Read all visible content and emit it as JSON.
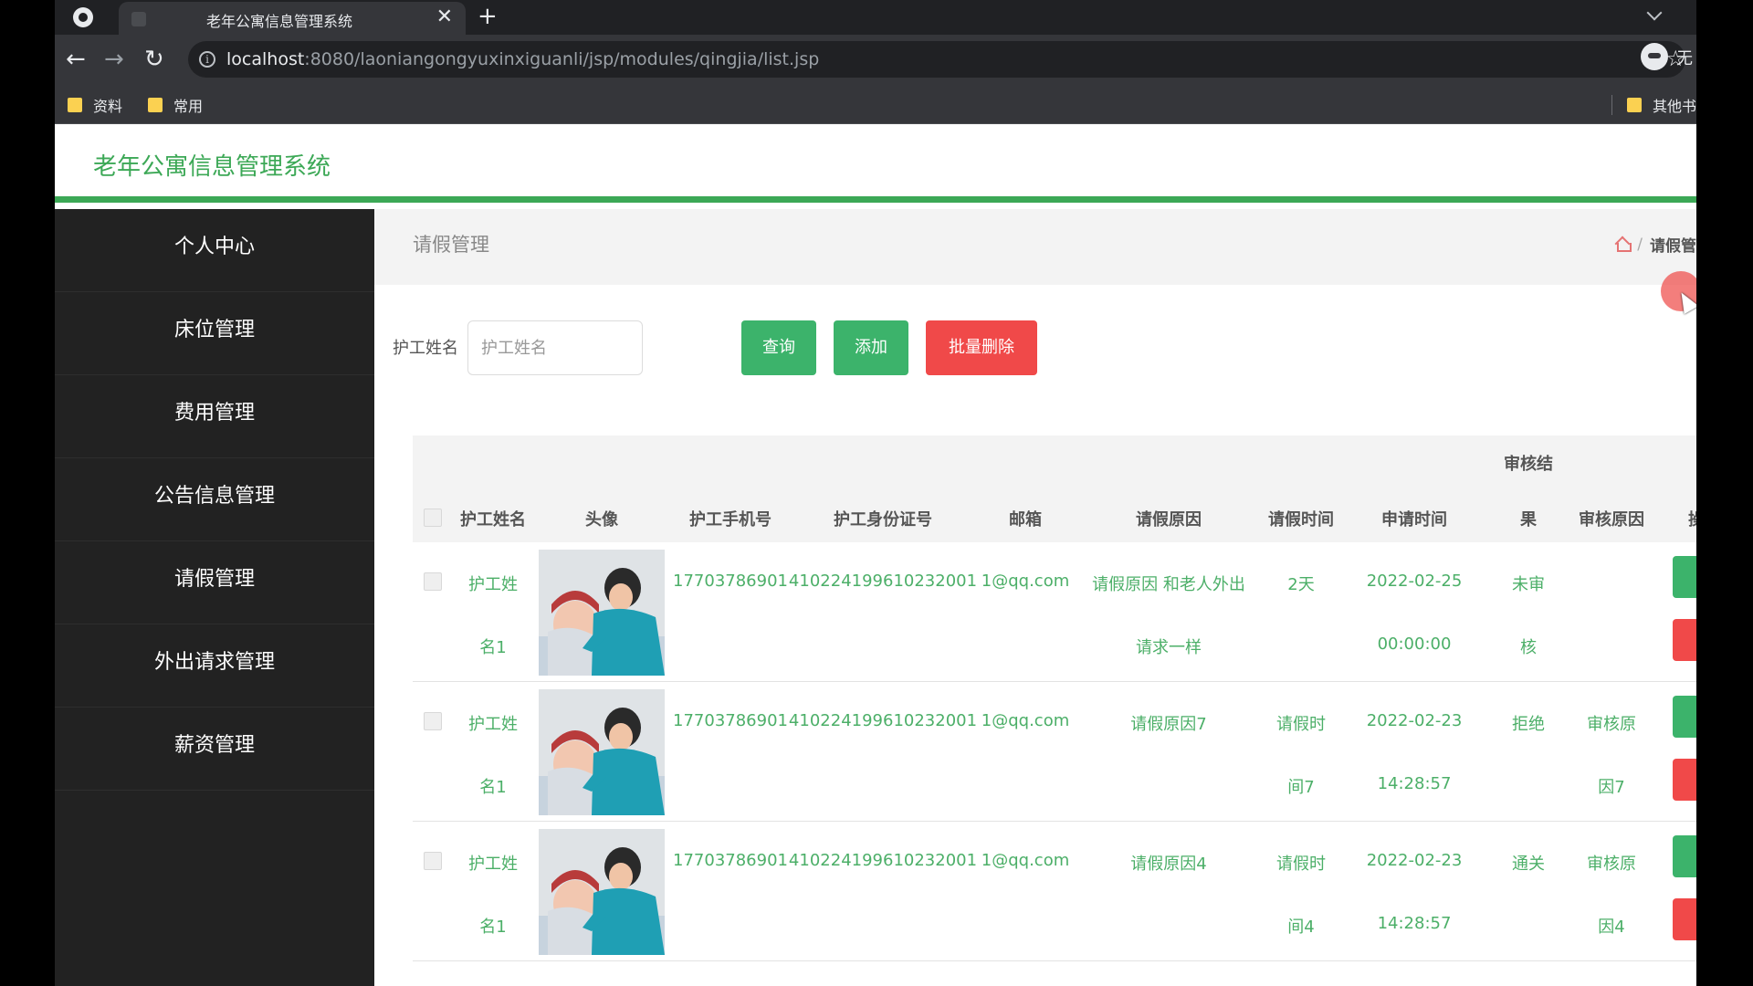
{
  "browser": {
    "tab_title": "老年公寓信息管理系统",
    "tab_close": "✕",
    "new_tab": "+",
    "url_host": "localhost",
    "url_rest": ":8080/laoniangongyuxinxiguanli/jsp/modules/qingjia/list.jsp",
    "profile_label": "无",
    "nav": {
      "back": "←",
      "forward": "→",
      "reload": "↻"
    },
    "star": "☆",
    "info": "i",
    "bookmarks": [
      {
        "label": "资料"
      },
      {
        "label": "常用"
      }
    ],
    "other_bookmarks": "其他书"
  },
  "app": {
    "title": "老年公寓信息管理系统",
    "sidebar": [
      {
        "label": "个人中心"
      },
      {
        "label": "床位管理"
      },
      {
        "label": "费用管理"
      },
      {
        "label": "公告信息管理"
      },
      {
        "label": "请假管理"
      },
      {
        "label": "外出请求管理"
      },
      {
        "label": "薪资管理"
      }
    ],
    "page_heading": "请假管理",
    "breadcrumb": {
      "separator": "/",
      "current": "请假管"
    }
  },
  "search": {
    "label": "护工姓名",
    "placeholder": "护工姓名",
    "query_button": "查询",
    "add_button": "添加",
    "batch_delete_button": "批量删除"
  },
  "table": {
    "headers": {
      "name": "护工姓名",
      "avatar": "头像",
      "phone": "护工手机号",
      "id_card": "护工身份证号",
      "email": "邮箱",
      "reason": "请假原因",
      "leave_time": "请假时间",
      "apply_time": "申请时间",
      "result_line1": "审核结",
      "result_line2": "果",
      "review_reason": "审核原因",
      "action": "操"
    },
    "rows": [
      {
        "name": [
          "护工姓",
          "名1"
        ],
        "phone": "17703786901",
        "id_card": "410224199610232001",
        "email": "1@qq.com",
        "reason": [
          "请假原因 和老人外出",
          "请求一样"
        ],
        "leave_time": [
          "2天",
          ""
        ],
        "apply_time": [
          "2022-02-25",
          "00:00:00"
        ],
        "result": [
          "未审",
          "核"
        ],
        "review_reason": [
          "",
          ""
        ]
      },
      {
        "name": [
          "护工姓",
          "名1"
        ],
        "phone": "17703786901",
        "id_card": "410224199610232001",
        "email": "1@qq.com",
        "reason": [
          "请假原因7",
          ""
        ],
        "leave_time": [
          "请假时",
          "间7"
        ],
        "apply_time": [
          "2022-02-23",
          "14:28:57"
        ],
        "result": [
          "拒绝",
          ""
        ],
        "review_reason": [
          "审核原",
          "因7"
        ]
      },
      {
        "name": [
          "护工姓",
          "名1"
        ],
        "phone": "17703786901",
        "id_card": "410224199610232001",
        "email": "1@qq.com",
        "reason": [
          "请假原因4",
          ""
        ],
        "leave_time": [
          "请假时",
          "间4"
        ],
        "apply_time": [
          "2022-02-23",
          "14:28:57"
        ],
        "result": [
          "通关",
          ""
        ],
        "review_reason": [
          "审核原",
          "因4"
        ]
      }
    ]
  },
  "colors": {
    "brand_green": "#3ca856",
    "button_green": "#3cb36b",
    "button_red": "#f04949",
    "sidebar_bg": "#222222"
  }
}
